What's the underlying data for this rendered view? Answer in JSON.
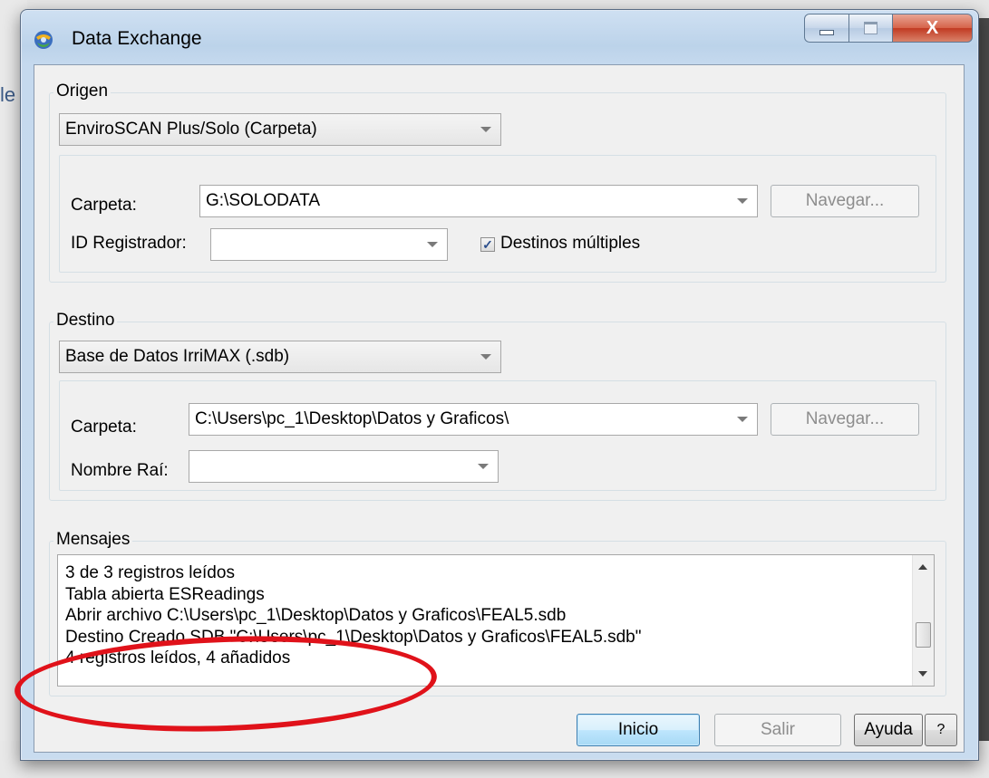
{
  "window": {
    "title": "Data Exchange",
    "close_glyph": "X"
  },
  "origen": {
    "group_label": "Origen",
    "source_type": "EnviroSCAN Plus/Solo (Carpeta)",
    "carpeta_label": "Carpeta:",
    "carpeta_value": "G:\\SOLODATA",
    "navegar_label": "Navegar...",
    "id_registrador_label": "ID Registrador:",
    "id_registrador_value": "",
    "destinos_multiples_label": "Destinos múltiples",
    "destinos_multiples_checked": true
  },
  "destino": {
    "group_label": "Destino",
    "dest_type": "Base de Datos IrriMAX (.sdb)",
    "carpeta_label": "Carpeta:",
    "carpeta_value": "C:\\Users\\pc_1\\Desktop\\Datos y Graficos\\",
    "navegar_label": "Navegar...",
    "nombre_raiz_label": "Nombre Raí:",
    "nombre_raiz_value": ""
  },
  "mensajes": {
    "group_label": "Mensajes",
    "lines": [
      "3 de 3 registros leídos",
      "Tabla abierta ESReadings",
      "Abrir archivo C:\\Users\\pc_1\\Desktop\\Datos y Graficos\\FEAL5.sdb",
      "Destino Creado SDB \"C:\\Users\\pc_1\\Desktop\\Datos y Graficos\\FEAL5.sdb\"",
      "4 registros leídos, 4 añadidos"
    ]
  },
  "footer": {
    "inicio_label": "Inicio",
    "salir_label": "Salir",
    "ayuda_label": "Ayuda",
    "help_cursor_glyph": "?"
  },
  "background": {
    "frag_top": "le"
  },
  "colors": {
    "annotation": "#e0121a",
    "title_bar": "#bcd3ea",
    "close_button": "#c13a22"
  }
}
